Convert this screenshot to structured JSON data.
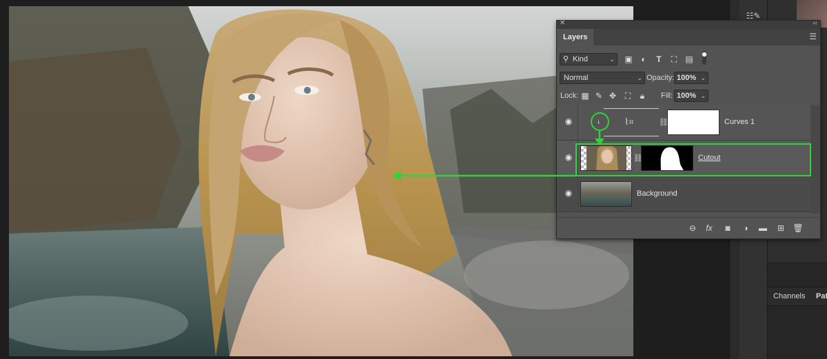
{
  "layers_panel": {
    "tab_label": "Layers",
    "filter_kind": "Kind",
    "blend_mode": "Normal",
    "opacity_label": "Opacity:",
    "opacity_value": "100%",
    "lock_label": "Lock:",
    "fill_label": "Fill:",
    "fill_value": "100%",
    "layers": [
      {
        "name": "Curves 1",
        "type": "adjustment-curves",
        "clipped": true,
        "visible": true
      },
      {
        "name": "Cutout",
        "type": "pixel-with-mask",
        "visible": true,
        "selected": true
      },
      {
        "name": "Background",
        "type": "pixel",
        "visible": true
      }
    ],
    "filter_icons": [
      "image-filter-icon",
      "adjustment-filter-icon",
      "type-filter-icon",
      "shape-filter-icon",
      "smart-object-filter-icon",
      "filter-toggle-icon"
    ],
    "lock_icons": [
      "lock-transparent-icon",
      "lock-brush-icon",
      "lock-move-icon",
      "lock-artboard-icon",
      "lock-all-icon"
    ],
    "bottom_icons": [
      "link-layers-icon",
      "fx-icon",
      "add-mask-icon",
      "adjustment-layer-icon",
      "new-group-icon",
      "new-layer-icon",
      "trash-icon"
    ]
  },
  "right_dock": {
    "channels_tab": "Channels",
    "paths_tab_partial": "Pat"
  },
  "annotation_color": "#33d13a"
}
